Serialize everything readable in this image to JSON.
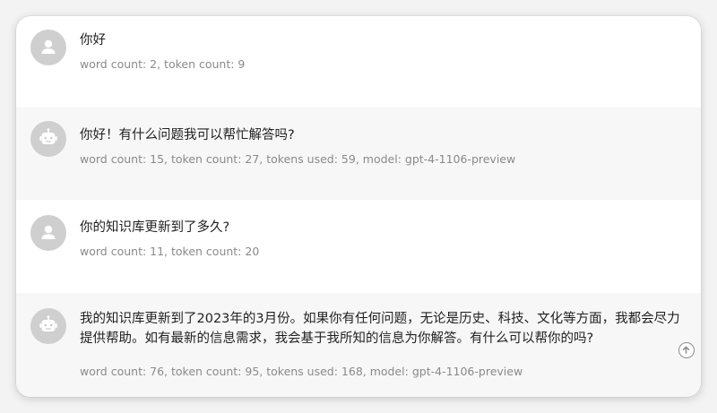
{
  "messages": [
    {
      "role": "user",
      "text": "你好",
      "meta": "word count: 2, token count: 9"
    },
    {
      "role": "assistant",
      "text": "你好！有什么问题我可以帮忙解答吗?",
      "meta": "word count: 15, token count: 27, tokens used: 59, model: gpt-4-1106-preview"
    },
    {
      "role": "user",
      "text": "你的知识库更新到了多久?",
      "meta": "word count: 11, token count: 20"
    },
    {
      "role": "assistant",
      "text": "我的知识库更新到了2023年的3月份。如果你有任何问题，无论是历史、科技、文化等方面，我都会尽力提供帮助。如有最新的信息需求，我会基于我所知的信息为你解答。有什么可以帮你的吗?",
      "meta": "word count: 76, token count: 95, tokens used: 168, model: gpt-4-1106-preview"
    }
  ],
  "icons": {
    "user_avatar": "user-icon",
    "bot_avatar": "robot-icon",
    "scroll_button": "arrow-up-icon"
  },
  "colors": {
    "avatar_bg": "#cfcfcf",
    "bot_row_bg": "#f7f7f7",
    "meta_text": "#8a8a8a"
  }
}
